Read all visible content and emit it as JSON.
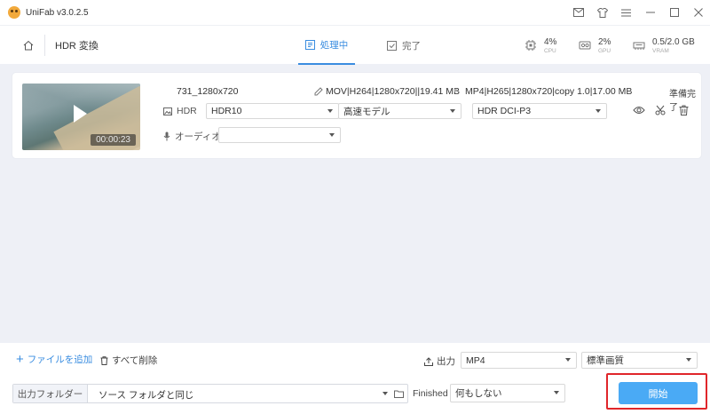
{
  "app": {
    "title": "UniFab v3.0.2.5"
  },
  "header": {
    "page_title": "HDR 変換",
    "tabs": [
      {
        "label": "処理中",
        "active": true
      },
      {
        "label": "完了",
        "active": false
      }
    ],
    "stats": {
      "cpu": {
        "value": "4%",
        "label": "CPU"
      },
      "gpu": {
        "value": "2%",
        "label": "GPU"
      },
      "mem": {
        "value": "0.5/2.0 GB",
        "label": "VRAM"
      }
    }
  },
  "file": {
    "duration": "00:00:23",
    "name": "731_1280x720",
    "source_info": "MOV|H264|1280x720||19.41 MB",
    "target_info": "MP4|H265|1280x720|copy 1.0|17.00 MB",
    "status": "準備完了",
    "hdr_label": "HDR",
    "hdr_format": "HDR10",
    "speed_mode": "高速モデル",
    "color_space": "HDR DCI-P3",
    "audio_label": "オーディオ",
    "audio_value": ""
  },
  "bottom": {
    "add_file": "ファイルを追加",
    "delete_all": "すべて削除",
    "output_label": "出力",
    "output_format": "MP4",
    "quality": "標準画質",
    "folder_label": "出力フォルダー",
    "folder_value": "ソース フォルダと同じ",
    "finished_label": "Finished",
    "finished_value": "何もしない",
    "start_label": "開始"
  },
  "colors": {
    "accent": "#3a8de0",
    "start_button": "#4aaaf5",
    "highlight_outline": "#e0262a",
    "background": "#eef0f6"
  }
}
